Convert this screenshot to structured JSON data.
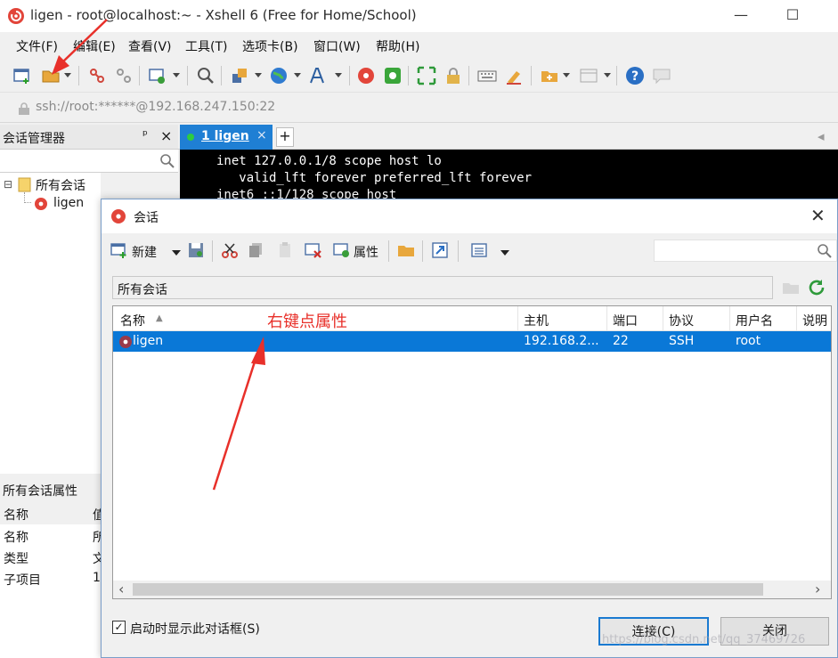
{
  "window": {
    "title": "ligen - root@localhost:~ - Xshell 6 (Free for Home/School)",
    "minimize_glyph": "—",
    "maximize_glyph": "☐"
  },
  "menu": [
    "文件(F)",
    "编辑(E)",
    "查看(V)",
    "工具(T)",
    "选项卡(B)",
    "窗口(W)",
    "帮助(H)"
  ],
  "address": {
    "text": "ssh://root:******@192.168.247.150:22"
  },
  "session_manager": {
    "title": "会话管理器",
    "pin_glyph": "ᵖ",
    "close_glyph": "×",
    "tree": {
      "root_toggle": "⊟",
      "root": "所有会话",
      "child": "ligen"
    }
  },
  "properties": {
    "title": "所有会话属性",
    "columns": [
      "名称",
      "值"
    ],
    "rows": [
      {
        "name": "名称",
        "value": "所有会话"
      },
      {
        "name": "类型",
        "value": "文件夹"
      },
      {
        "name": "子项目",
        "value": "1"
      }
    ]
  },
  "tabs": {
    "active_label": "1 ligen",
    "close_glyph": "×",
    "new_glyph": "+"
  },
  "terminal": {
    "lines": [
      "inet 127.0.0.1/8 scope host lo",
      "   valid_lft forever preferred_lft forever",
      "inet6 ::1/128 scope host"
    ]
  },
  "dialog": {
    "title": "会话",
    "close_glyph": "✕",
    "new_label": "新建",
    "properties_label": "属性",
    "path": "所有会话",
    "columns": [
      "名称",
      "主机",
      "端口",
      "协议",
      "用户名",
      "说明"
    ],
    "sort_glyph": "▲",
    "rows": [
      {
        "name": "ligen",
        "host": "192.168.2...",
        "port": "22",
        "protocol": "SSH",
        "user": "root",
        "desc": ""
      }
    ],
    "annotation": "右键点属性",
    "startup_check_label": "启动时显示此对话框(S)",
    "check_glyph": "✓",
    "connect_label": "连接(C)",
    "close_label": "关闭",
    "scroll_left": "‹",
    "scroll_right": "›"
  },
  "watermark": "https://blog.csdn.net/qq_37469726",
  "colors": {
    "accent": "#0a78d7",
    "tab_active": "#1f7fd4",
    "annotation": "#e8302a",
    "terminal_bg": "#000000"
  }
}
